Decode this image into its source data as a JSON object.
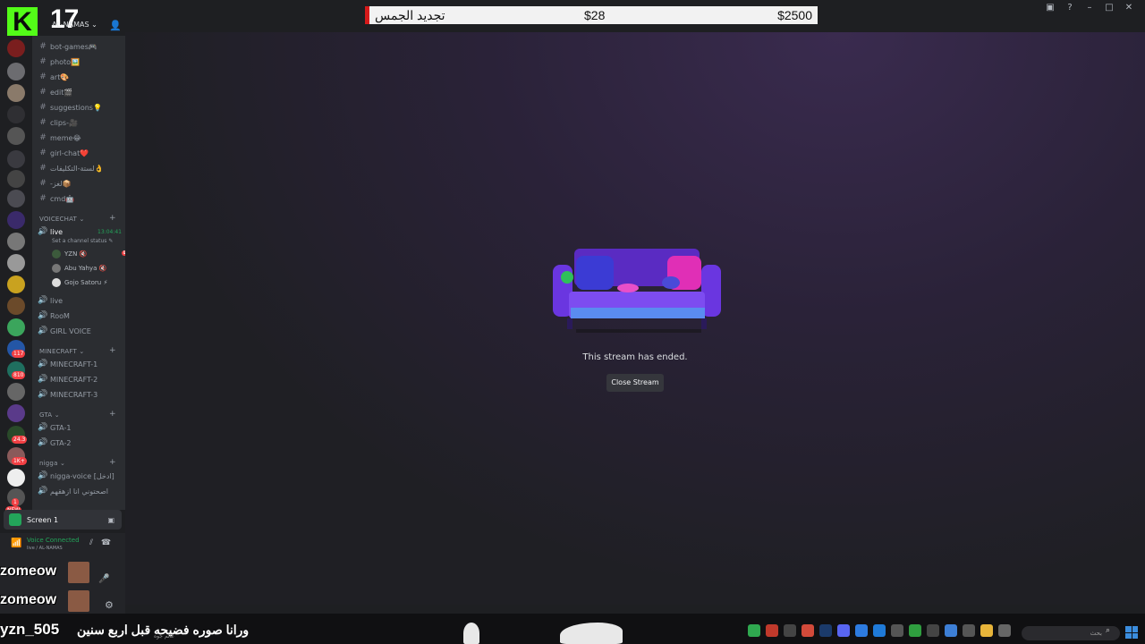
{
  "overlay": {
    "logo_letter": "K",
    "viewer_count": "17",
    "donation": {
      "left": "$2500",
      "middle": "$28",
      "right": "تجديد الجمس"
    },
    "caption_user": "yzn_505",
    "caption_text": "ورانا صوره فضيحه قبل اربع سنين",
    "caption_sub": "عالم جوه"
  },
  "server": {
    "name": "AL-NAMAS ⌄"
  },
  "channels": [
    {
      "name": "bot-games🎮"
    },
    {
      "name": "photo🖼️"
    },
    {
      "name": "art🎨"
    },
    {
      "name": "edit🎬"
    },
    {
      "name": "suggestions💡"
    },
    {
      "name": "clips-🎥"
    },
    {
      "name": "meme😂"
    },
    {
      "name": "girl-chat❤️"
    },
    {
      "name": "لستة-التكليفات👌"
    },
    {
      "name": "-لغز📦"
    },
    {
      "name": "cmd🤖"
    }
  ],
  "voice_category": {
    "name": "VOICECHAT ⌄"
  },
  "voice_live": {
    "name": "live",
    "timer": "13:04:41",
    "status": "Set a channel status ✎"
  },
  "voice_users": [
    {
      "name": "YZN 🔇",
      "badge": "LIVE"
    },
    {
      "name": "Abu Yahya 🔇",
      "badge": ""
    },
    {
      "name": "Gojo Satoru ⚡",
      "badge": ""
    }
  ],
  "voice_channels_more": [
    {
      "name": "live"
    },
    {
      "name": "RooM"
    },
    {
      "name": "GIRL VOICE"
    }
  ],
  "minecraft_category": {
    "name": "MINECRAFT ⌄"
  },
  "minecraft_channels": [
    {
      "name": "MINECRAFT-1"
    },
    {
      "name": "MINECRAFT-2"
    },
    {
      "name": "MINECRAFT-3"
    }
  ],
  "gta_category": {
    "name": "GTA ⌄"
  },
  "gta_channels": [
    {
      "name": "GTA-1"
    },
    {
      "name": "GTA-2"
    }
  ],
  "nigga_category": {
    "name": "nigga ⌄"
  },
  "nigga_channels": [
    {
      "name": "nigga-voice [ادخل]"
    },
    {
      "name": "اصحتوني انا ازهقهم"
    }
  ],
  "server_badges": [
    "117",
    "810",
    "24.3",
    "1K+",
    "1",
    "NEW"
  ],
  "screen_share": {
    "label": "Screen 1"
  },
  "voice_panel": {
    "status": "Voice Connected",
    "channel": "live / AL-NAMAS"
  },
  "user_panel": {
    "name_1": "zomeow",
    "name_2": "zomeow"
  },
  "stream": {
    "ended_message": "This stream has ended.",
    "close_button": "Close Stream"
  },
  "taskbar": {
    "search_placeholder": "بحث"
  },
  "colors": {
    "accent_green": "#23a55a",
    "live_red": "#ed4245",
    "kick_green": "#53fc18",
    "sofa_purple": "#6b2fd6"
  }
}
